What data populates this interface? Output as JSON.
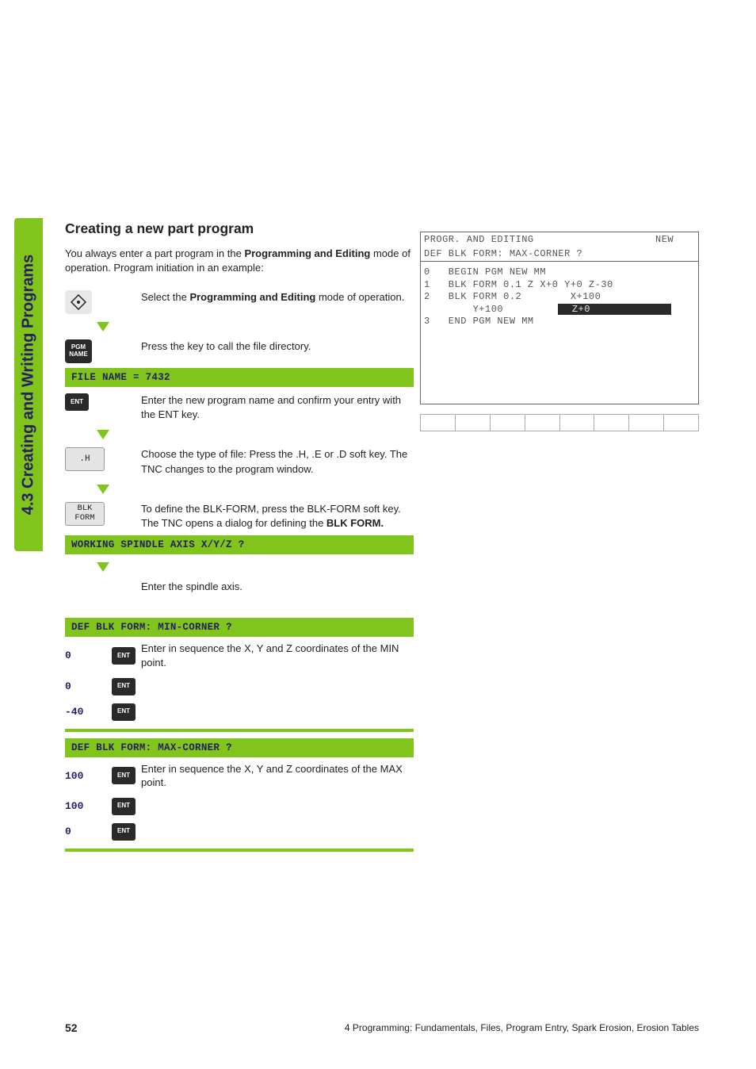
{
  "side_tab": "4.3 Creating and Writing Programs",
  "heading": "Creating a new part program",
  "intro_pre": "You always enter a part program in the ",
  "intro_bold": "Programming and Editing",
  "intro_post": " mode of operation. Program initiation in an example:",
  "step_select_pre": "Select the ",
  "step_select_bold": "Programming and Editing",
  "step_select_post": " mode of operation.",
  "pgm_name_key": "PGM\nNAME",
  "step_pgmname": "Press the key to call the file directory.",
  "bar_filename": "FILE NAME = 7432",
  "ent_key": "ENT",
  "step_ent": "Enter the new program name and confirm your entry with the ENT key.",
  "softkey_h": ".H",
  "step_h": "Choose the type of file: Press the .H, .E or .D soft key. The TNC changes to the program window.",
  "softkey_blkform": "BLK\nFORM",
  "step_blkform_pre": "To define the BLK-FORM, press the BLK-FORM soft key. The TNC opens a dialog for defining the ",
  "step_blkform_bold": "BLK FORM.",
  "bar_spindle": "WORKING SPINDLE AXIS X/Y/Z ?",
  "step_spindle": "Enter the spindle axis.",
  "bar_min": "DEF BLK FORM: MIN-CORNER ?",
  "min_text": "Enter in sequence the X, Y and Z coordinates of the MIN point.",
  "min_coords": [
    "0",
    "0",
    "-40"
  ],
  "bar_max": "DEF BLK FORM: MAX-CORNER ?",
  "max_text": "Enter in sequence the X, Y and Z coordinates of the MAX point.",
  "max_coords": [
    "100",
    "100",
    "0"
  ],
  "screenshot": {
    "header_left": "PROGR. AND EDITING",
    "header_right": "NEW",
    "subheader": "DEF BLK FORM: MAX-CORNER ?",
    "lines": [
      {
        "n": "0",
        "t": "BEGIN PGM NEW MM"
      },
      {
        "n": "1",
        "t": "BLK FORM 0.1 Z X+0 Y+0 Z-30"
      },
      {
        "n": "2",
        "t": "BLK FORM 0.2",
        "extra": "X+100"
      },
      {
        "n": "",
        "t": "    Y+100",
        "hl": "Z+0"
      },
      {
        "n": "3",
        "t": "END PGM NEW MM"
      }
    ]
  },
  "footer": {
    "page": "52",
    "text": "4 Programming: Fundamentals, Files, Program Entry, Spark Erosion, Erosion Tables"
  }
}
